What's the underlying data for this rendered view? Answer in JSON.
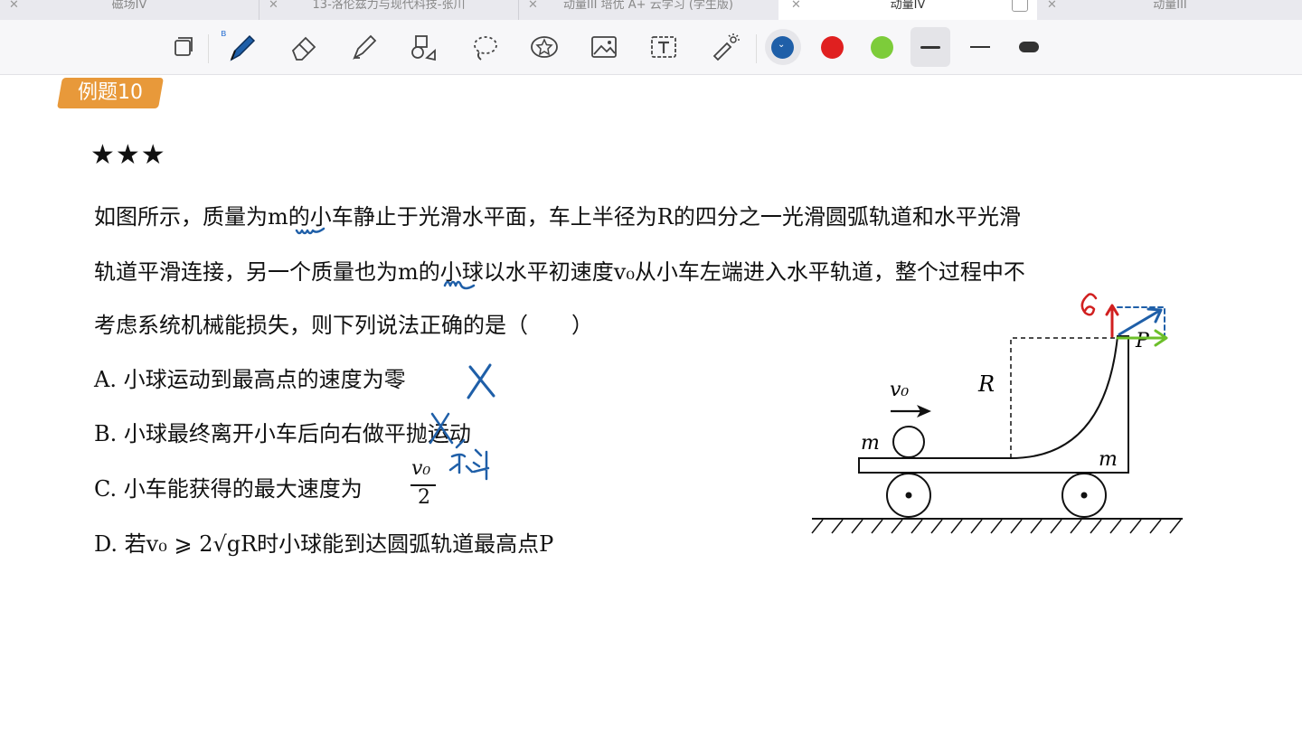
{
  "tabs": [
    {
      "label": "磁场IV",
      "active": false
    },
    {
      "label": "13-洛伦兹力与现代科技-张川",
      "active": false
    },
    {
      "label": "动量III 培优 A+ 云学习 (学生版)",
      "active": false
    },
    {
      "label": "动量IV",
      "active": true
    },
    {
      "label": "动量III",
      "active": false
    }
  ],
  "toolbar": {
    "tools": [
      "pages-icon",
      "pen-icon",
      "eraser-icon",
      "highlighter-icon",
      "shapes-icon",
      "lasso-icon",
      "sticker-icon",
      "image-icon",
      "text-icon",
      "laser-pointer-icon"
    ],
    "colors": [
      "#1f5fa8",
      "#e02020",
      "#7dcc3a"
    ],
    "bluetooth": "ʙ"
  },
  "problem": {
    "badge": "例题10",
    "stars": "★★★",
    "line1": "如图所示，质量为m的小车静止于光滑水平面，车上半径为R的四分之一光滑圆弧轨道和水平光滑",
    "line2": "轨道平滑连接，另一个质量也为m的小球以水平初速度v₀从小车左端进入水平轨道，整个过程中不",
    "line3": "考虑系统机械能损失，则下列说法正确的是（　　）",
    "optA": "A. 小球运动到最高点的速度为零",
    "optB": "B. 小球最终离开小车后向右做平抛运动",
    "optC": "C. 小车能获得的最大速度为",
    "optC_num": "v₀",
    "optC_den": "2",
    "optD": "D. 若v₀ ⩾ 2√gR时小球能到达圆弧轨道最高点P"
  },
  "figure": {
    "label_v0": "v₀",
    "label_R": "R",
    "label_m_ball": "m",
    "label_m_cart": "m",
    "label_P": "P"
  },
  "annotations": {
    "handwritten_oblique": "斜"
  }
}
